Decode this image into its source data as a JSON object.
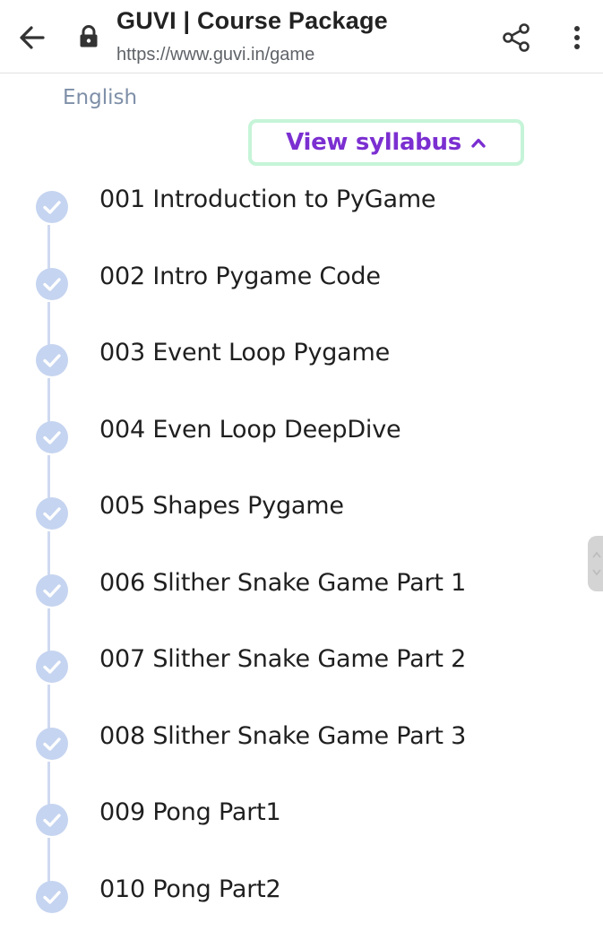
{
  "header": {
    "title": "GUVI | Course Package",
    "url": "https://www.guvi.in/game"
  },
  "course": {
    "language": "English",
    "syllabus_button": "View syllabus"
  },
  "lessons": [
    {
      "label": "001 Introduction to PyGame",
      "completed": true
    },
    {
      "label": "002 Intro Pygame Code",
      "completed": true
    },
    {
      "label": "003 Event Loop Pygame",
      "completed": true
    },
    {
      "label": "004 Even Loop DeepDive",
      "completed": true
    },
    {
      "label": "005 Shapes Pygame",
      "completed": true
    },
    {
      "label": "006 Slither Snake Game Part 1",
      "completed": true
    },
    {
      "label": "007 Slither Snake Game Part 2",
      "completed": true
    },
    {
      "label": "008 Slither Snake Game Part 3",
      "completed": true
    },
    {
      "label": "009 Pong Part1",
      "completed": true
    },
    {
      "label": "010 Pong Part2",
      "completed": true
    }
  ],
  "icons": {
    "back": "arrow-left-icon",
    "lock": "lock-icon",
    "share": "share-icon",
    "more": "more-vert-icon",
    "caret": "chevron-up-icon",
    "check": "check-circle-icon"
  },
  "colors": {
    "accent": "#7b2fd1",
    "syllabus_border": "#c6f4d8",
    "check_fill": "#c5d4f0",
    "timeline": "#cfdaf0",
    "language_text": "#7e8fa8"
  }
}
